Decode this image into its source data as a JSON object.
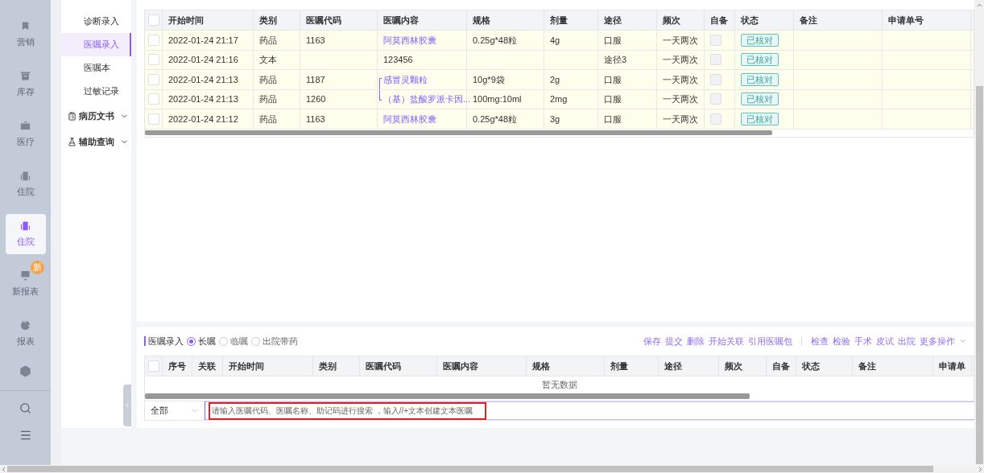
{
  "nav": [
    {
      "label": "营销",
      "selected": false
    },
    {
      "label": "库存",
      "selected": false
    },
    {
      "label": "医疗",
      "selected": false
    },
    {
      "label": "住院",
      "selected": false
    },
    {
      "label": "住院",
      "selected": true
    },
    {
      "label": "新报表",
      "selected": false,
      "badge": "新"
    },
    {
      "label": "报表",
      "selected": false
    }
  ],
  "submenu": [
    {
      "kind": "item",
      "label": "诊断录入",
      "selected": false
    },
    {
      "kind": "item",
      "label": "医嘱录入",
      "selected": true
    },
    {
      "kind": "item",
      "label": "医嘱本",
      "selected": false
    },
    {
      "kind": "item",
      "label": "过敏记录",
      "selected": false
    },
    {
      "kind": "group",
      "label": "病历文书",
      "expanded": false
    },
    {
      "kind": "group",
      "label": "辅助查询",
      "expanded": false
    }
  ],
  "orders_table": {
    "all_selected": false,
    "columns": [
      "开始时间",
      "类别",
      "医嘱代码",
      "医嘱内容",
      "规格",
      "剂量",
      "途径",
      "频次",
      "自备",
      "状态",
      "备注",
      "申请单号"
    ],
    "rows": [
      {
        "selected": false,
        "start": "2022-01-24 21:17",
        "category": "药品",
        "code": "1163",
        "content": "阿莫西林胶囊",
        "kind": "drug",
        "linked": false,
        "spec": "0.25g*48粒",
        "dose": "4g",
        "route": "口服",
        "frequency": "一天两次",
        "self_supplied": false,
        "status": "已核对"
      },
      {
        "selected": false,
        "start": "2022-01-24 21:16",
        "category": "文本",
        "code": "",
        "content": "123456",
        "kind": "text",
        "linked": false,
        "spec": "",
        "dose": "",
        "route": "途径3",
        "frequency": "一天两次",
        "self_supplied": false,
        "status": "已核对"
      },
      {
        "selected": false,
        "start": "2022-01-24 21:13",
        "category": "药品",
        "code": "1187",
        "content": "感冒灵颗粒",
        "kind": "drug",
        "linked": true,
        "spec": "10g*9袋",
        "dose": "2g",
        "route": "口服",
        "frequency": "一天两次",
        "self_supplied": false,
        "status": "已核对"
      },
      {
        "selected": false,
        "start": "2022-01-24 21:13",
        "category": "药品",
        "code": "1260",
        "content": "（基）盐酸罗派卡因...",
        "kind": "drug",
        "linked": true,
        "spec": "100mg:10ml",
        "dose": "2mg",
        "route": "口服",
        "frequency": "一天两次",
        "self_supplied": false,
        "status": "已核对"
      },
      {
        "selected": false,
        "start": "2022-01-24 21:12",
        "category": "药品",
        "code": "1163",
        "content": "阿莫西林胶囊",
        "kind": "drug",
        "linked": false,
        "spec": "0.25g*48粒",
        "dose": "3g",
        "route": "口服",
        "frequency": "一天两次",
        "self_supplied": false,
        "status": "已核对"
      }
    ]
  },
  "entry": {
    "title": "医嘱录入",
    "order_types": [
      {
        "label": "长嘱",
        "selected": true
      },
      {
        "label": "临嘱",
        "selected": false
      },
      {
        "label": "出院带药",
        "selected": false
      }
    ],
    "actions": [
      "保存",
      "提交",
      "删除",
      "开始关联",
      "引用医嘱包"
    ],
    "actions_2": [
      "检查",
      "检验",
      "手术",
      "皮试",
      "出院",
      "更多操作"
    ],
    "all_selected": false,
    "columns": [
      "序号",
      "关联",
      "开始时间",
      "类别",
      "医嘱代码",
      "医嘱内容",
      "规格",
      "剂量",
      "途径",
      "频次",
      "自备",
      "状态",
      "备注",
      "申请单"
    ],
    "empty_text": "暂无数据",
    "filter": "全部",
    "placeholder": "请输入医嘱代码、医嘱名称、助记码进行搜索 ，输入//+文本创建文本医嘱"
  }
}
